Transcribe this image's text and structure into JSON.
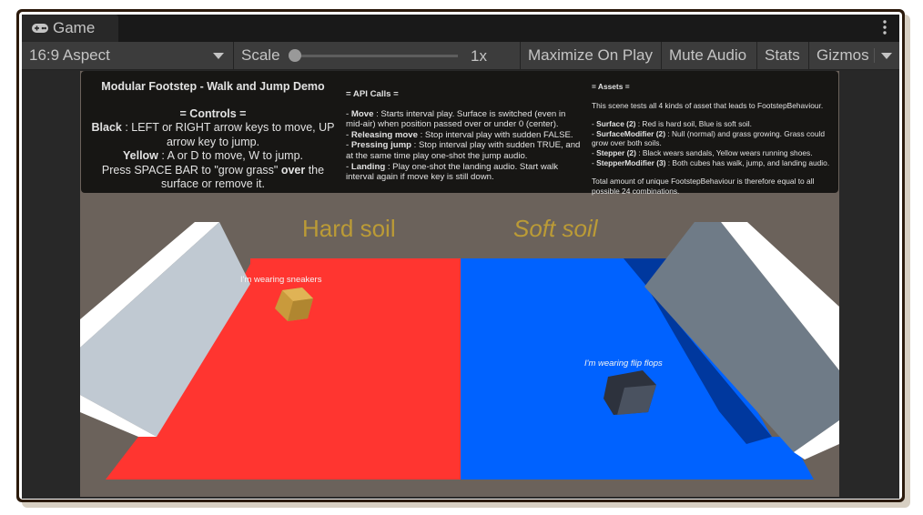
{
  "window": {
    "tab_label": "Game",
    "tab_icon": "gamepad-icon",
    "more_icon": "kebab-menu-icon"
  },
  "toolbar": {
    "aspect": "16:9 Aspect",
    "scale_label": "Scale",
    "scale_value": "1x",
    "scale_fraction": 0.0,
    "maximize_on_play": "Maximize On Play",
    "mute_audio": "Mute Audio",
    "stats": "Stats",
    "gizmos": "Gizmos"
  },
  "info": {
    "title": "Modular Footstep - Walk and Jump Demo",
    "controls_header": "= Controls =",
    "controls": [
      {
        "bold": "Black",
        "text": " : LEFT or RIGHT arrow keys to move, UP arrow key to jump."
      },
      {
        "bold": "Yellow",
        "text": " : A or D to move, W to jump."
      }
    ],
    "grass_pre": "Press SPACE BAR to \"grow grass\" ",
    "grass_bold": "over",
    "grass_post": " the surface or remove it.",
    "api_header": "= API Calls =",
    "api": [
      {
        "bold": "Move",
        "text": " : Starts interval play. Surface is switched (even in mid-air) when position passed over or under 0 (center)."
      },
      {
        "bold": "Releasing move",
        "text": " : Stop interval play with sudden FALSE."
      },
      {
        "bold": "Pressing jump",
        "text": " : Stop interval play with sudden TRUE, and at the same time play one-shot the jump audio."
      },
      {
        "bold": "Landing",
        "text": " : Play one-shot the landing audio. Start walk interval again if move key is still down."
      }
    ],
    "assets_header": "= Assets =",
    "assets_intro": "This scene tests all 4 kinds of asset that leads to FootstepBehaviour.",
    "assets": [
      {
        "bold": "Surface (2)",
        "text": " : Red is hard soil, Blue is soft soil."
      },
      {
        "bold": "SurfaceModifier (2)",
        "text": " : Null (normal) and grass growing. Grass could grow over both soils."
      },
      {
        "bold": "Stepper (2)",
        "text": " : Black wears sandals, Yellow wears running shoes."
      },
      {
        "bold": "StepperModifier (3)",
        "text": " : Both cubes has walk, jump, and landing audio."
      }
    ],
    "assets_total": "Total amount of unique FootstepBehaviour is therefore equal to all possible 24 combinations."
  },
  "scene": {
    "hard_label": "Hard soil",
    "soft_label": "Soft soil",
    "yellow_cube_text": "I'm wearing sneakers",
    "black_cube_text": "I'm wearing flip flops",
    "colors": {
      "background": "#6b625b",
      "hard_floor": "#ff3530",
      "soft_floor": "#0062ff",
      "soft_shadow": "#00389e",
      "wall_light": "#c0c9d2",
      "wall_dark": "#6f7b87",
      "wall_top": "#ffffff",
      "yellow_cube": "#d7a847",
      "black_cube": "#4a5260",
      "label_gold": "#c9a530"
    }
  }
}
